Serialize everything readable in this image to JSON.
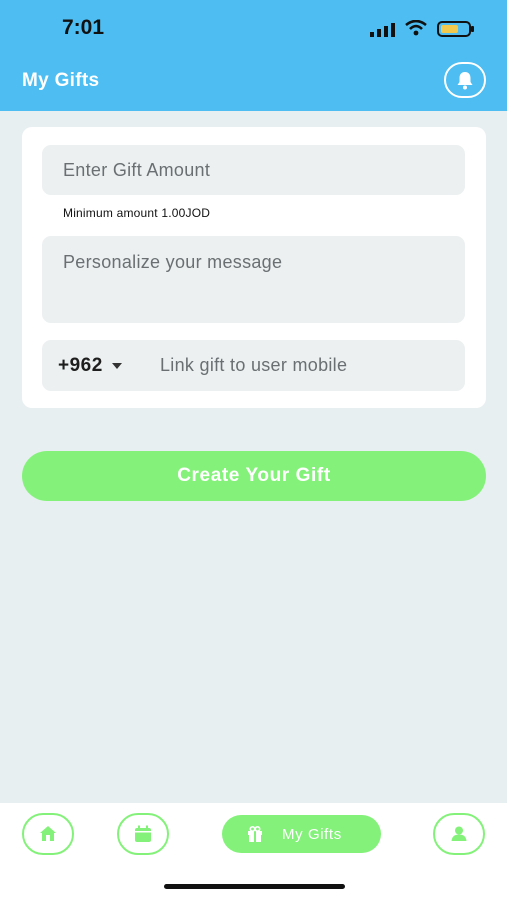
{
  "status_bar": {
    "time": "7:01",
    "icons": [
      "signal-icon",
      "wifi-icon",
      "battery-icon"
    ],
    "battery_color": "#f2c94c"
  },
  "header": {
    "title": "My Gifts",
    "bell_icon": "bell-icon",
    "background": "#4dbdf2"
  },
  "form": {
    "amount_placeholder": "Enter Gift Amount",
    "amount_hint": "Minimum amount 1.00JOD",
    "message_placeholder": "Personalize your message",
    "country_code": "+962",
    "mobile_placeholder": "Link gift to user mobile"
  },
  "create_button": {
    "label": "Create Your Gift",
    "color": "#84f27a"
  },
  "tab_bar": {
    "items": [
      {
        "icon": "home-icon",
        "label": ""
      },
      {
        "icon": "calendar-icon",
        "label": ""
      },
      {
        "icon": "gift-icon",
        "label": "My Gifts",
        "active": true
      },
      {
        "icon": "profile-icon",
        "label": ""
      }
    ],
    "accent": "#84f27a"
  }
}
